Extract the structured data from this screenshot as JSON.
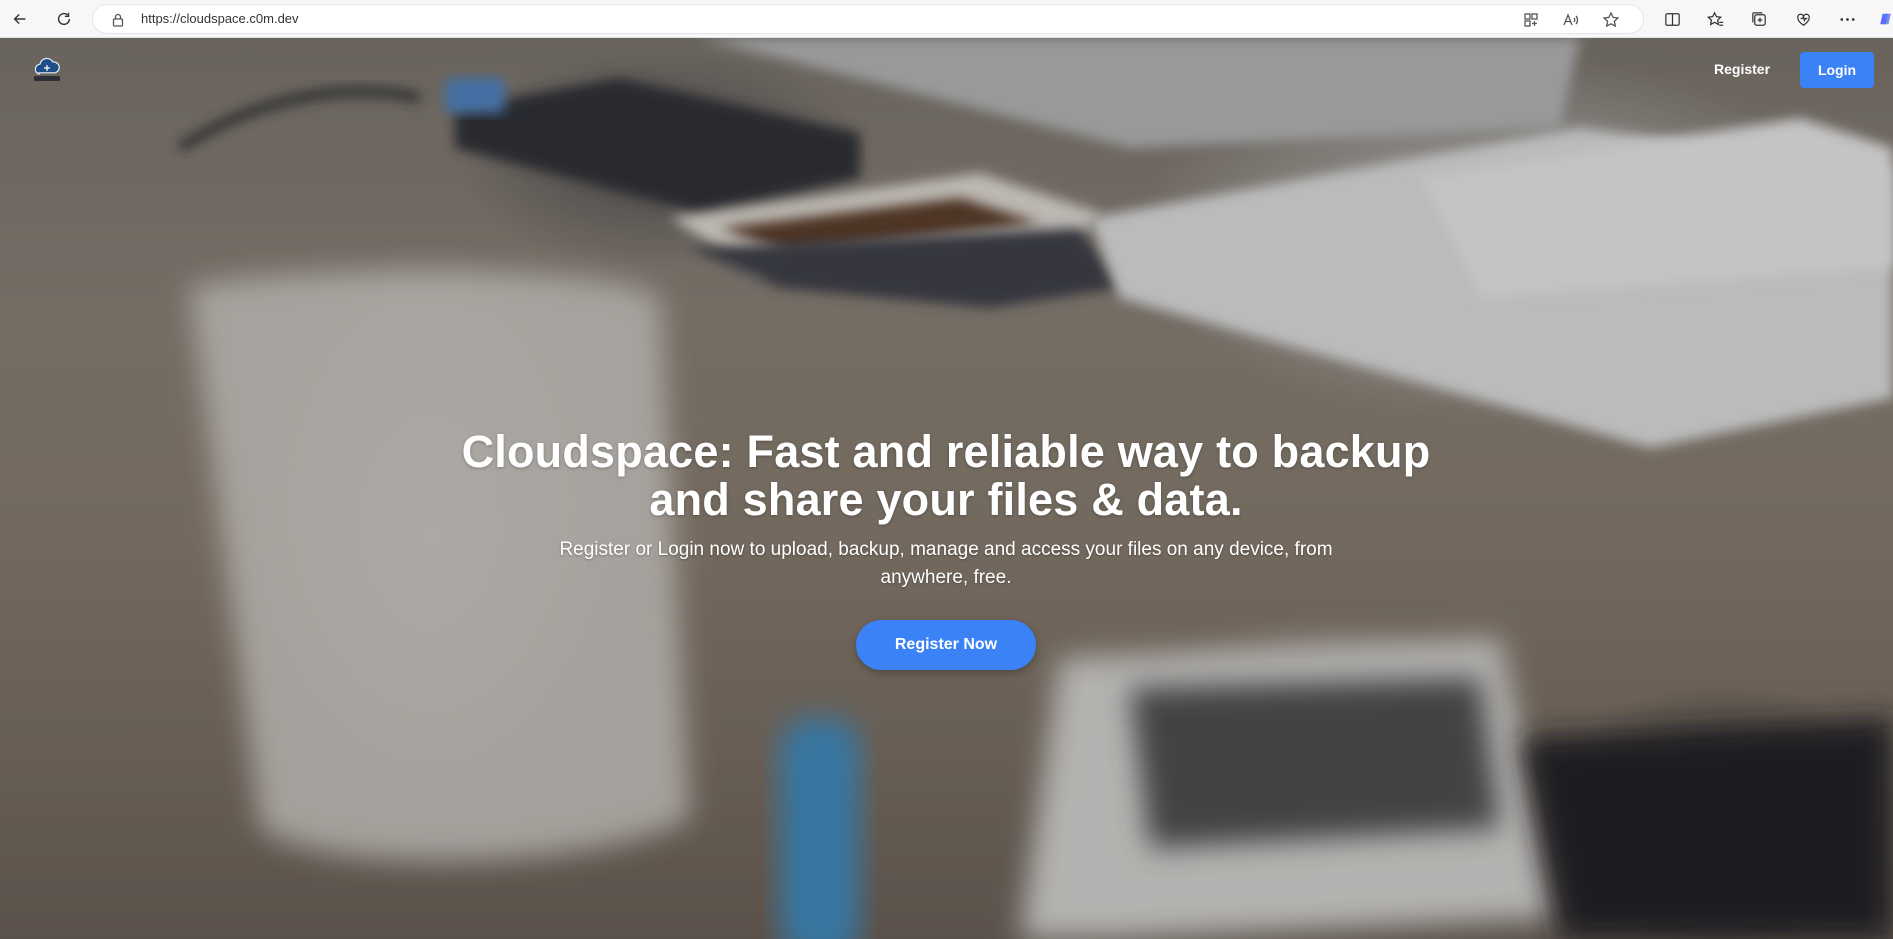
{
  "browser": {
    "url": "https://cloudspace.c0m.dev"
  },
  "site": {
    "logo_text": "Cloudspace",
    "nav": {
      "register_label": "Register",
      "login_label": "Login"
    }
  },
  "hero": {
    "title": "Cloudspace: Fast and reliable way to backup and share your files & data.",
    "subtitle": "Register or Login now to upload, backup, manage and access your files on any device, from anywhere, free.",
    "cta_label": "Register Now"
  },
  "colors": {
    "accent": "#3b82f6"
  }
}
